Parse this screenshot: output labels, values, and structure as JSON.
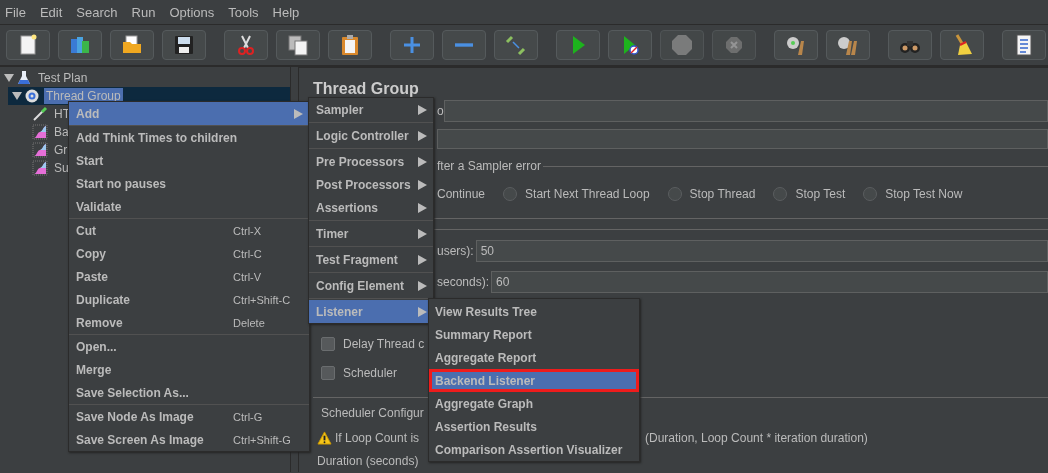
{
  "menu_bar": [
    "File",
    "Edit",
    "Search",
    "Run",
    "Options",
    "Tools",
    "Help"
  ],
  "toolbar": [
    [
      {
        "kind": "new",
        "disabled": false
      },
      {
        "kind": "templates",
        "disabled": false
      },
      {
        "kind": "open",
        "disabled": false
      },
      {
        "kind": "save",
        "disabled": false
      }
    ],
    [
      {
        "kind": "cut",
        "disabled": false
      },
      {
        "kind": "copy",
        "disabled": false
      },
      {
        "kind": "paste",
        "disabled": false
      }
    ],
    [
      {
        "kind": "expand",
        "disabled": false
      },
      {
        "kind": "collapse",
        "disabled": false
      },
      {
        "kind": "toggle",
        "disabled": false
      }
    ],
    [
      {
        "kind": "start",
        "disabled": false
      },
      {
        "kind": "start_no_pause",
        "disabled": false
      },
      {
        "kind": "stop",
        "disabled": true
      },
      {
        "kind": "shutdown",
        "disabled": true
      }
    ],
    [
      {
        "kind": "clear",
        "disabled": false
      },
      {
        "kind": "clear_all",
        "disabled": false
      }
    ],
    [
      {
        "kind": "search",
        "disabled": false
      },
      {
        "kind": "reset_search",
        "disabled": false
      }
    ],
    [
      {
        "kind": "functions",
        "disabled": false
      }
    ]
  ],
  "tree": [
    {
      "label": "Test Plan",
      "kind": "plan",
      "expanded": true,
      "selected": false,
      "children": [
        {
          "label": "Thread Group",
          "kind": "threads",
          "expanded": true,
          "selected": true,
          "children": [
            {
              "label": "HT",
              "kind": "sampler",
              "selected": false
            },
            {
              "label": "Ba",
              "kind": "listener",
              "selected": false
            },
            {
              "label": "Gr",
              "kind": "listener",
              "selected": false
            },
            {
              "label": "Su",
              "kind": "listener",
              "selected": false
            }
          ]
        }
      ]
    }
  ],
  "panel": {
    "title": "Thread Group",
    "name_fragment": "o",
    "error_legend": "fter a Sampler error",
    "continue_label": "Continue",
    "error_options": [
      {
        "label": "Start Next Thread Loop",
        "selected": false
      },
      {
        "label": "Stop Thread",
        "selected": false
      },
      {
        "label": "Stop Test",
        "selected": false
      },
      {
        "label": "Stop Test Now",
        "selected": false
      }
    ],
    "threads_label": "users):",
    "threads_value": "50",
    "rampup_label": "seconds):",
    "rampup_value": "60",
    "checkboxes": [
      {
        "label": "Delay Thread c",
        "checked": false
      },
      {
        "label": "Scheduler",
        "checked": false
      }
    ],
    "scheduler_legend": "Scheduler Configur",
    "warning_start": "If Loop Count is",
    "warning_end": "(Duration, Loop Count * iteration duration)",
    "duration_label": "Duration (seconds)"
  },
  "context_menu": [
    [
      {
        "label": "Add",
        "submenu": true,
        "selected": true
      }
    ],
    [
      {
        "label": "Add Think Times to children",
        "selected": false
      },
      {
        "label": "Start",
        "selected": false
      },
      {
        "label": "Start no pauses",
        "selected": false
      },
      {
        "label": "Validate",
        "selected": false
      }
    ],
    [
      {
        "label": "Cut",
        "shortcut": "Ctrl-X",
        "selected": false
      },
      {
        "label": "Copy",
        "shortcut": "Ctrl-C",
        "selected": false
      },
      {
        "label": "Paste",
        "shortcut": "Ctrl-V",
        "selected": false
      },
      {
        "label": "Duplicate",
        "shortcut": "Ctrl+Shift-C",
        "selected": false
      },
      {
        "label": "Remove",
        "shortcut": "Delete",
        "selected": false
      }
    ],
    [
      {
        "label": "Open...",
        "selected": false
      },
      {
        "label": "Merge",
        "selected": false
      },
      {
        "label": "Save Selection As...",
        "selected": false
      }
    ],
    [
      {
        "label": "Save Node As Image",
        "shortcut": "Ctrl-G",
        "selected": false
      },
      {
        "label": "Save Screen As Image",
        "shortcut": "Ctrl+Shift-G",
        "selected": false
      }
    ]
  ],
  "add_menu": [
    [
      {
        "label": "Sampler",
        "selected": false
      }
    ],
    [
      {
        "label": "Logic Controller",
        "selected": false
      }
    ],
    [
      {
        "label": "Pre Processors",
        "selected": false
      },
      {
        "label": "Post Processors",
        "selected": false
      },
      {
        "label": "Assertions",
        "selected": false
      }
    ],
    [
      {
        "label": "Timer",
        "selected": false
      }
    ],
    [
      {
        "label": "Test Fragment",
        "selected": false
      }
    ],
    [
      {
        "label": "Config Element",
        "selected": false
      }
    ],
    [
      {
        "label": "Listener",
        "selected": true
      }
    ]
  ],
  "listener_menu": [
    {
      "label": "View Results Tree",
      "selected": false,
      "outlined": false
    },
    {
      "label": "Summary Report",
      "selected": false,
      "outlined": false
    },
    {
      "label": "Aggregate Report",
      "selected": false,
      "outlined": false
    },
    {
      "label": "Backend Listener",
      "selected": true,
      "outlined": true
    },
    {
      "label": "Aggregate Graph",
      "selected": false,
      "outlined": false
    },
    {
      "label": "Assertion Results",
      "selected": false,
      "outlined": false
    },
    {
      "label": "Comparison Assertion Visualizer",
      "selected": false,
      "outlined": false
    }
  ]
}
